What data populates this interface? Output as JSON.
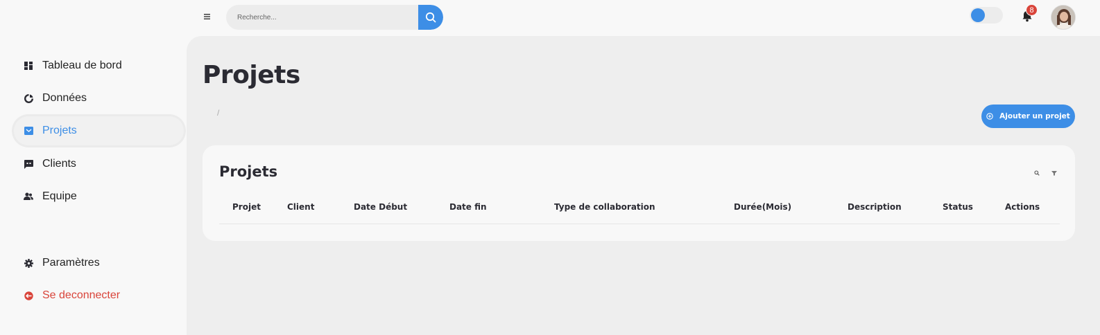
{
  "header": {
    "menu_icon": "hamburger-icon",
    "search": {
      "placeholder": "Recherche...",
      "value": "",
      "icon": "search-icon"
    },
    "theme_toggle": {
      "state": "on",
      "accent": "#3d8ee6"
    },
    "notifications": {
      "count": "8",
      "icon": "bell-icon"
    },
    "avatar": "user-avatar"
  },
  "sidebar": {
    "items": [
      {
        "label": "Tableau de bord",
        "icon": "dashboard-icon"
      },
      {
        "label": "Données",
        "icon": "pie-chart-icon"
      },
      {
        "label": "Projets",
        "icon": "inbox-icon",
        "active": true
      },
      {
        "label": "Clients",
        "icon": "chat-icon"
      },
      {
        "label": "Equipe",
        "icon": "team-icon"
      }
    ],
    "bottom_items": [
      {
        "label": "Paramètres",
        "icon": "gear-icon"
      },
      {
        "label": "Se deconnecter",
        "icon": "logout-icon"
      }
    ]
  },
  "main": {
    "page_title": "Projets",
    "breadcrumb_separator": "/",
    "add_button": {
      "label": "Ajouter un projet",
      "icon": "add-circle-icon"
    },
    "card": {
      "title": "Projets",
      "tools": [
        "search-icon",
        "filter-icon"
      ],
      "columns": [
        "Projet",
        "Client",
        "Date Début",
        "Date fin",
        "Type de collaboration",
        "Durée(Mois)",
        "Description",
        "Status",
        "Actions"
      ],
      "rows": []
    }
  },
  "colors": {
    "accent": "#3d8ee6",
    "danger": "#d9443a",
    "text": "#2b2b33",
    "background": "#eeeeee"
  }
}
